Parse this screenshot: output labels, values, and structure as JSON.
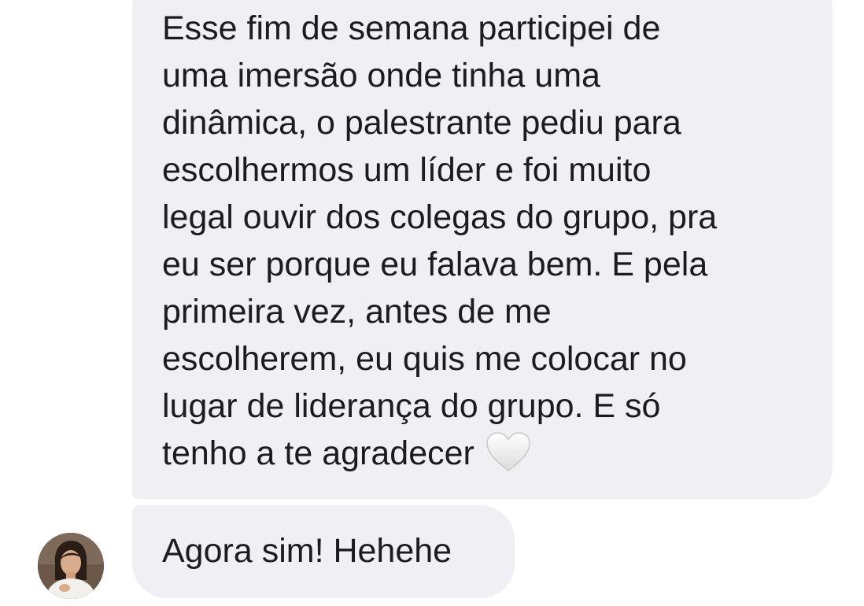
{
  "conversation": {
    "messages": [
      {
        "lines": [
          "Esse fim de semana participei de",
          "uma imersão onde tinha uma",
          "dinâmica, o palestrante pediu para",
          "escolhermos um líder e foi muito",
          "legal ouvir dos colegas do grupo, pra",
          "eu ser porque eu falava bem. E pela",
          "primeira vez, antes de me",
          "escolherem, eu quis me colocar no",
          "lugar de liderança do grupo. E só",
          "tenho a te agradecer"
        ],
        "emoji": "white-heart-icon"
      },
      {
        "text": "Agora sim! Hehehe"
      }
    ],
    "avatar_icon": "profile-photo-avatar",
    "bubble_color": "#efeff4",
    "text_color": "#1c1c1e"
  }
}
